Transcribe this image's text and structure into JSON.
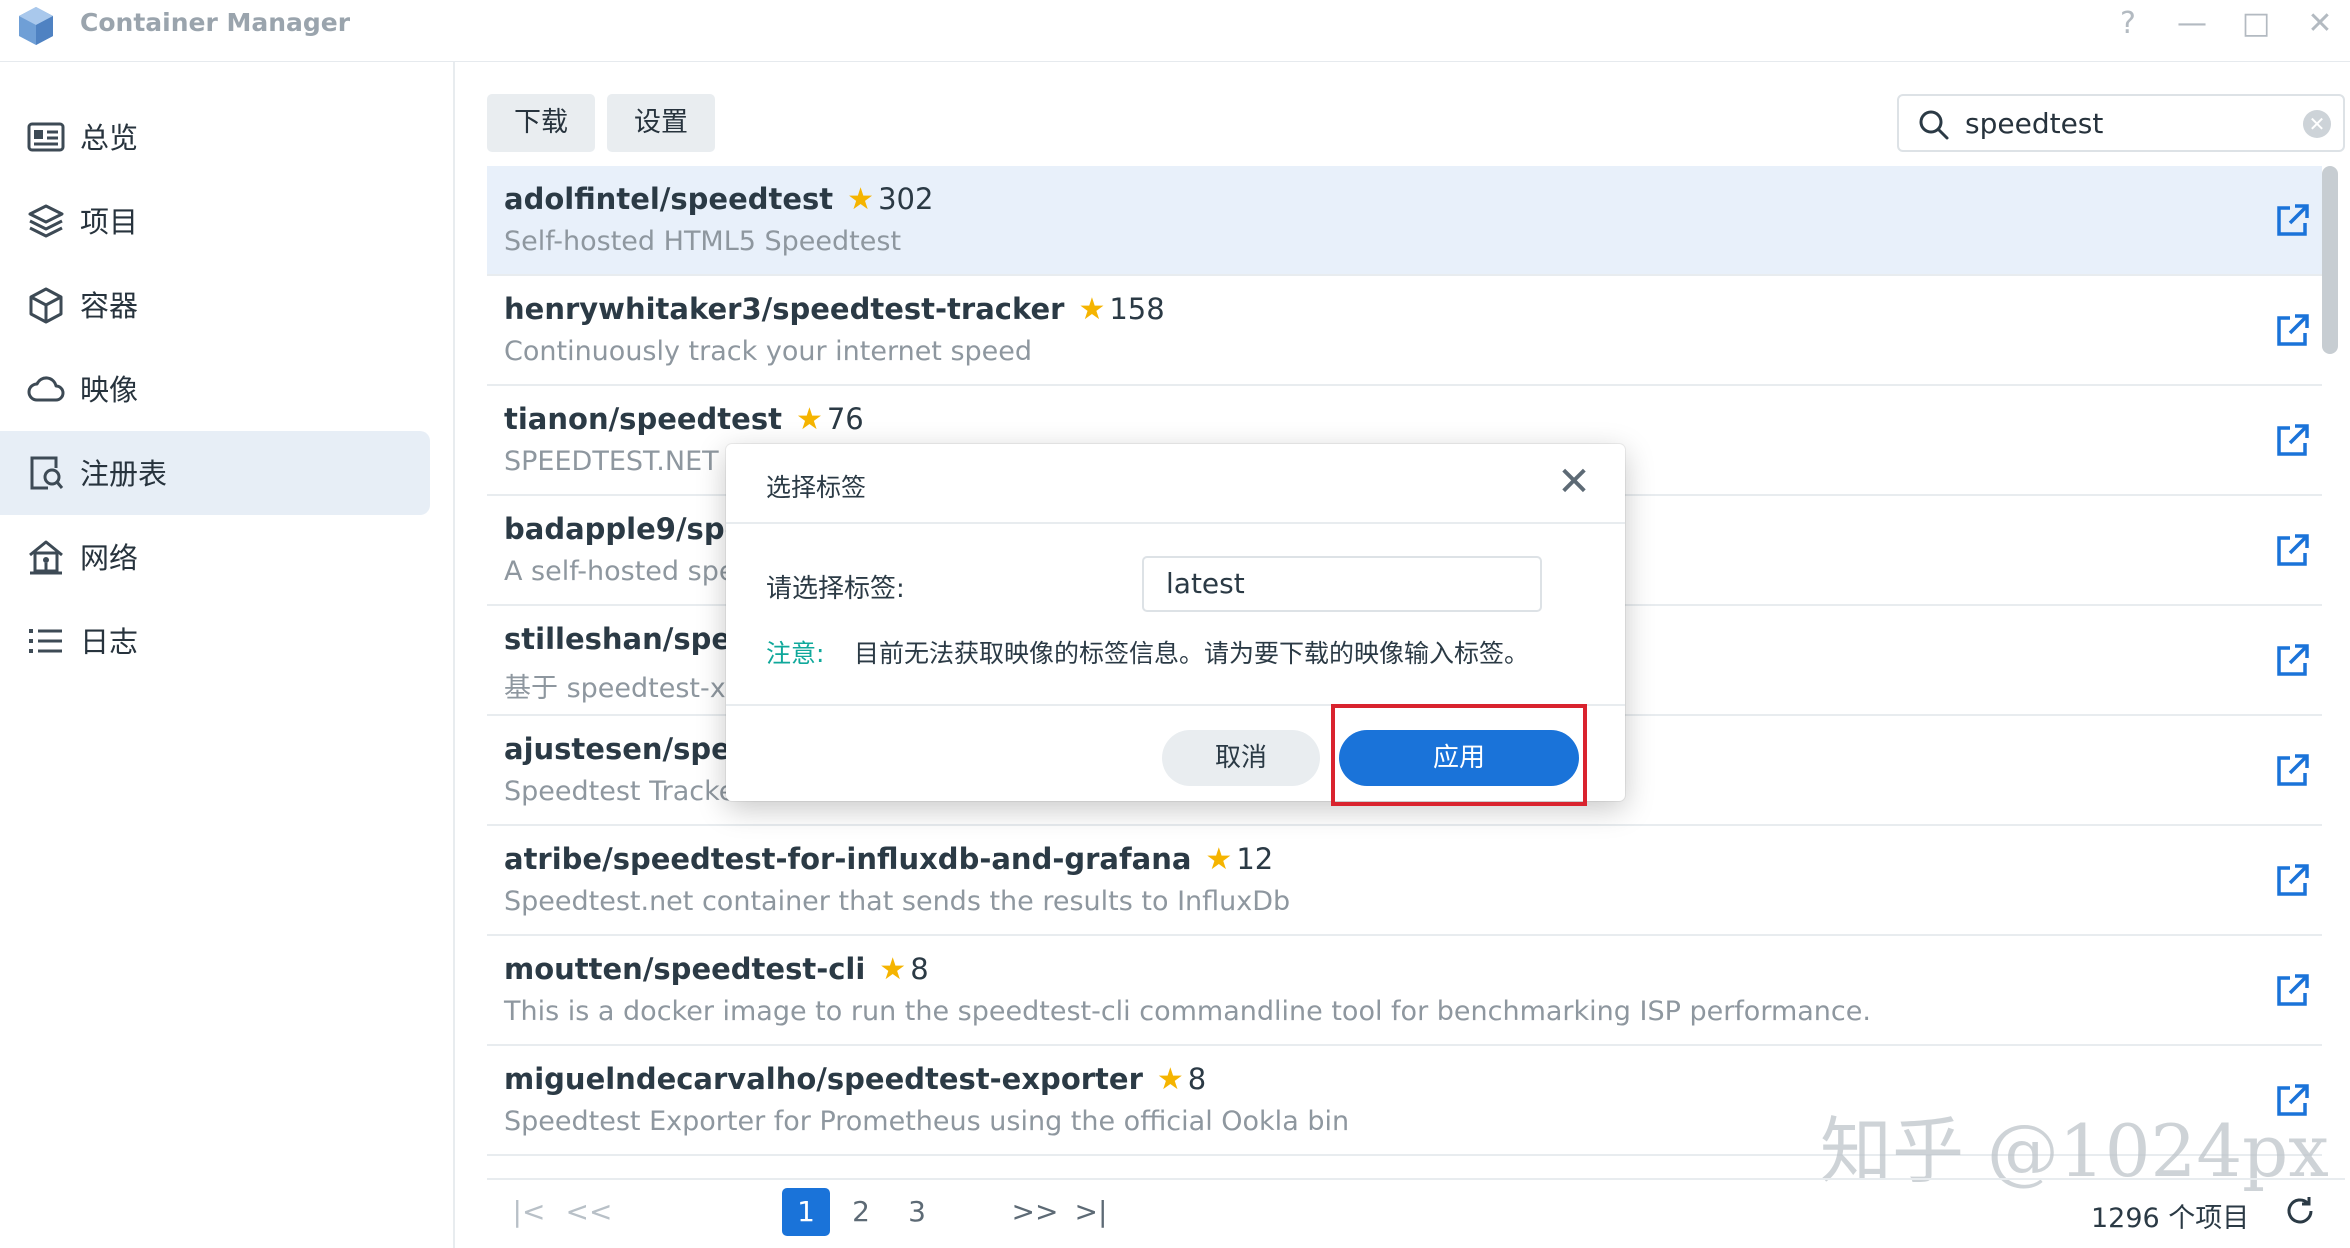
{
  "app": {
    "title": "Container Manager"
  },
  "window_controls": {
    "help": "?",
    "minimize": "—",
    "maximize": "□",
    "close": "✕"
  },
  "sidebar": {
    "items": [
      {
        "label": "总览",
        "icon": "overview-icon"
      },
      {
        "label": "项目",
        "icon": "layers-icon"
      },
      {
        "label": "容器",
        "icon": "cube-icon"
      },
      {
        "label": "映像",
        "icon": "cloud-icon"
      },
      {
        "label": "注册表",
        "icon": "registry-search-icon",
        "active": true
      },
      {
        "label": "网络",
        "icon": "network-home-icon"
      },
      {
        "label": "日志",
        "icon": "list-icon"
      }
    ]
  },
  "toolbar": {
    "download_label": "下载",
    "settings_label": "设置"
  },
  "search": {
    "value": "speedtest",
    "clear": "✕"
  },
  "results": [
    {
      "name": "adolfintel/speedtest",
      "stars": "302",
      "desc": "Self-hosted HTML5 Speedtest"
    },
    {
      "name": "henrywhitaker3/speedtest-tracker",
      "stars": "158",
      "desc": "Continuously track your internet speed"
    },
    {
      "name": "tianon/speedtest",
      "stars": "76",
      "desc": "SPEEDTEST.NET"
    },
    {
      "name": "badapple9/spe",
      "stars": "",
      "desc": "A self-hosted spe"
    },
    {
      "name": "stilleshan/spee",
      "stars": "",
      "desc": "基于 speedtest-x"
    },
    {
      "name": "ajustesen/spee",
      "stars": "",
      "desc": "Speedtest Tracke"
    },
    {
      "name": "atribe/speedtest-for-influxdb-and-grafana",
      "stars": "12",
      "desc": "Speedtest.net container that sends the results to InfluxDb"
    },
    {
      "name": "moutten/speedtest-cli",
      "stars": "8",
      "desc": "This is a docker image to run the speedtest-cli commandline tool for benchmarking ISP performance."
    },
    {
      "name": "miguelndecarvalho/speedtest-exporter",
      "stars": "8",
      "desc": "Speedtest Exporter for Prometheus using the official Ookla bin"
    }
  ],
  "pagination": {
    "first": "|<",
    "prev": "<<",
    "pages": [
      "1",
      "2",
      "3"
    ],
    "current": "1",
    "next": ">>",
    "last": ">|",
    "total": "1296 个项目"
  },
  "modal": {
    "title": "选择标签",
    "close": "✕",
    "field_label": "请选择标签:",
    "field_value": "latest",
    "note_key": "注意:",
    "note_text": "目前无法获取映像的标签信息。请为要下载的映像输入标签。",
    "cancel_label": "取消",
    "apply_label": "应用"
  },
  "watermark": "知乎 @1024px",
  "colors": {
    "accent": "#1a73d9",
    "star": "#f5b400",
    "note": "#10a89b",
    "highlight": "#d9232e",
    "selected_row": "#e8f0fa"
  }
}
